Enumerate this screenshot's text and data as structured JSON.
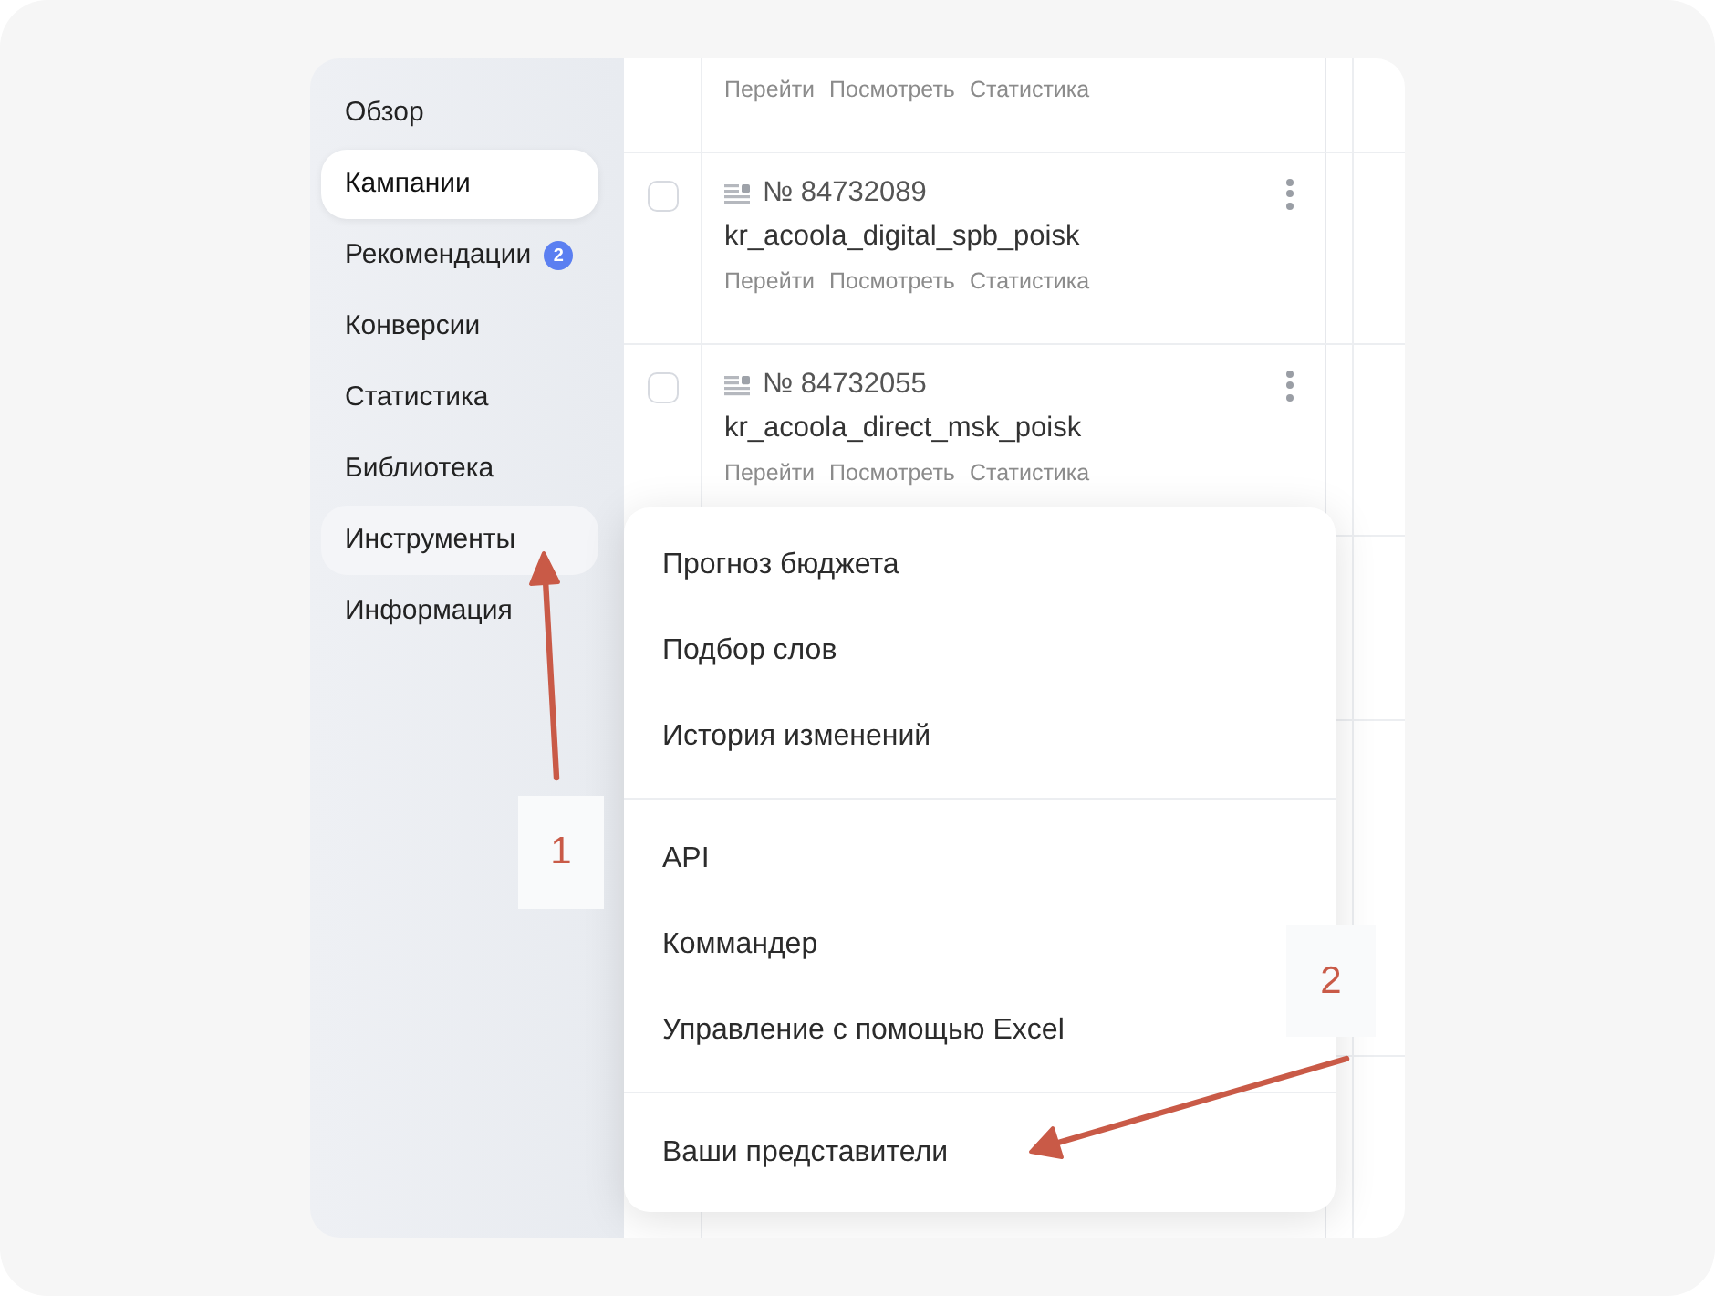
{
  "sidebar": {
    "items": [
      {
        "label": "Обзор",
        "selected": false,
        "hovered": false
      },
      {
        "label": "Кампании",
        "selected": true,
        "hovered": false
      },
      {
        "label": "Рекомендации",
        "selected": false,
        "hovered": false,
        "badge": "2"
      },
      {
        "label": "Конверсии",
        "selected": false,
        "hovered": false
      },
      {
        "label": "Статистика",
        "selected": false,
        "hovered": false
      },
      {
        "label": "Библиотека",
        "selected": false,
        "hovered": false
      },
      {
        "label": "Инструменты",
        "selected": false,
        "hovered": true
      },
      {
        "label": "Информация",
        "selected": false,
        "hovered": false
      }
    ]
  },
  "table": {
    "rows": [
      {
        "kind": "cut",
        "links": [
          "Перейти",
          "Посмотреть",
          "Статистика"
        ]
      },
      {
        "kind": "campaign",
        "checked": false,
        "number": "№ 84732089",
        "name": "kr_acoola_digital_spb_poisk",
        "links": [
          "Перейти",
          "Посмотреть",
          "Статистика"
        ]
      },
      {
        "kind": "campaign",
        "checked": false,
        "number": "№ 84732055",
        "name": "kr_acoola_direct_msk_poisk",
        "links": [
          "Перейти",
          "Посмотреть",
          "Статистика"
        ]
      }
    ]
  },
  "menu": {
    "groups": [
      {
        "items": [
          "Прогноз бюджета",
          "Подбор слов",
          "История изменений"
        ]
      },
      {
        "items": [
          "API",
          "Коммандер",
          "Управление с помощью Excel"
        ]
      },
      {
        "items": [
          "Ваши представители"
        ]
      }
    ]
  },
  "annotations": [
    {
      "label": "1"
    },
    {
      "label": "2"
    }
  ]
}
